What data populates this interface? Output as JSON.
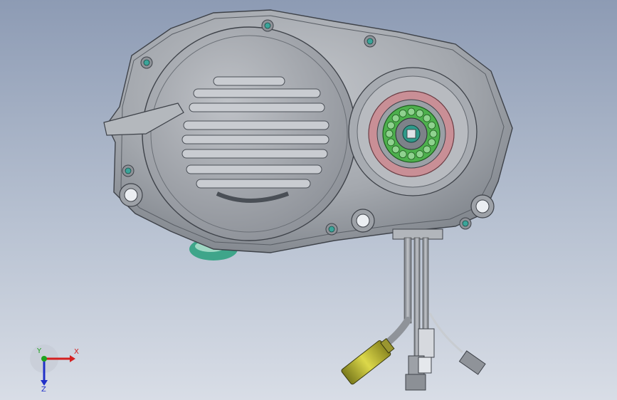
{
  "viewport": {
    "background_top": "#8d9bb4",
    "background_bottom": "#d8dde6"
  },
  "model": {
    "housing_color": "#a9adb3",
    "bearing_seal_color": "#c98f96",
    "bearing_cage_color": "#4db04d",
    "connector_color": "#c8c43a",
    "cable_color": "#8f9399"
  },
  "triad": {
    "x_label": "X",
    "y_label": "Y",
    "z_label": "Z",
    "x_color": "#d42020",
    "y_color": "#1fa21f",
    "z_color": "#2030c8"
  }
}
